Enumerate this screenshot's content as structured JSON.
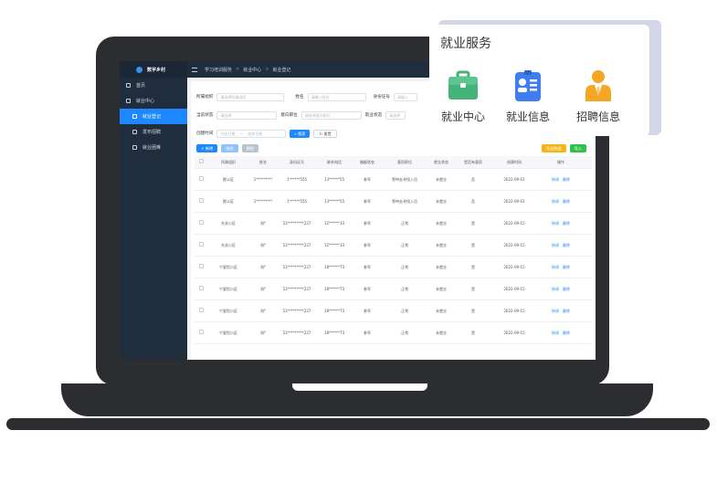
{
  "app": {
    "brand": "数字乡村"
  },
  "breadcrumb": [
    "学习培训服务",
    "就业中心",
    "就业登记"
  ],
  "sidebar": {
    "items": [
      {
        "label": "首页"
      },
      {
        "label": "就业中心"
      },
      {
        "label": "就业登记"
      },
      {
        "label": "发布招聘"
      },
      {
        "label": "就业困难"
      }
    ]
  },
  "filters": {
    "org_label": "所属组织",
    "org_placeholder": "请选择所属组织",
    "name_label": "姓名",
    "name_placeholder": "请输入姓名",
    "id_label": "身份证号",
    "id_placeholder": "请输入",
    "current_label": "当前状态",
    "current_placeholder": "请选择",
    "intent_label": "意向职位",
    "intent_placeholder": "请选择意向职位",
    "emp_label": "就业状态",
    "emp_placeholder": "请选择",
    "time_label": "创建时间",
    "time_start": "开始日期",
    "time_sep": "~",
    "time_end": "结束日期",
    "search_btn": "搜索",
    "reset_btn": "重置"
  },
  "toolbar": {
    "add": "+ 新增",
    "edit": "修改",
    "delete": "删除",
    "export": "导出数据",
    "import": "导入"
  },
  "table": {
    "headers": [
      "",
      "所属组织",
      "姓名",
      "身份证号",
      "联系电话",
      "婚姻状态",
      "意愿职位",
      "就业状态",
      "是否有意愿",
      "创建时间",
      "操作"
    ],
    "edit_label": "修改",
    "delete_label": "删除",
    "rows": [
      {
        "org": "颜义区",
        "name": "1*********",
        "id": "1******555",
        "phone": "13******55",
        "marital": "参军",
        "intent": "等待去寻找入员",
        "emp": "未就业",
        "will": "否",
        "created": "2022-09-01"
      },
      {
        "org": "颜义区",
        "name": "1*********",
        "id": "1******555",
        "phone": "13******55",
        "marital": "参军",
        "intent": "等待去寻找入员",
        "emp": "未就业",
        "will": "否",
        "created": "2022-09-01"
      },
      {
        "org": "东关小区",
        "name": "测*",
        "id": "53*********237",
        "phone": "12******33",
        "marital": "参军",
        "intent": "正常",
        "emp": "未就业",
        "will": "是",
        "created": "2022-09-15"
      },
      {
        "org": "东关小区",
        "name": "测*",
        "id": "53*********237",
        "phone": "12******33",
        "marital": "参军",
        "intent": "正常",
        "emp": "未就业",
        "will": "是",
        "created": "2022-09-15"
      },
      {
        "org": "宁夏铝小区",
        "name": "测*",
        "id": "53*********237",
        "phone": "18******73",
        "marital": "参军",
        "intent": "正常",
        "emp": "未就业",
        "will": "是",
        "created": "2022-09-15"
      },
      {
        "org": "宁夏铝小区",
        "name": "测*",
        "id": "53*********237",
        "phone": "18******73",
        "marital": "参军",
        "intent": "正常",
        "emp": "未就业",
        "will": "是",
        "created": "2022-09-15"
      },
      {
        "org": "宁夏铝小区",
        "name": "测*",
        "id": "53*********237",
        "phone": "18******73",
        "marital": "参军",
        "intent": "正常",
        "emp": "未就业",
        "will": "是",
        "created": "2022-09-15"
      },
      {
        "org": "宁夏铝小区",
        "name": "测*",
        "id": "53*********237",
        "phone": "18******73",
        "marital": "参军",
        "intent": "正常",
        "emp": "未就业",
        "will": "是",
        "created": "2022-09-15"
      }
    ]
  },
  "card": {
    "title": "就业服务",
    "items": [
      {
        "label": "就业中心",
        "icon": "briefcase-icon",
        "color": "#43b37a"
      },
      {
        "label": "就业信息",
        "icon": "id-card-icon",
        "color": "#3f7ef0"
      },
      {
        "label": "招聘信息",
        "icon": "recruiter-icon",
        "color": "#f5a623"
      }
    ]
  }
}
